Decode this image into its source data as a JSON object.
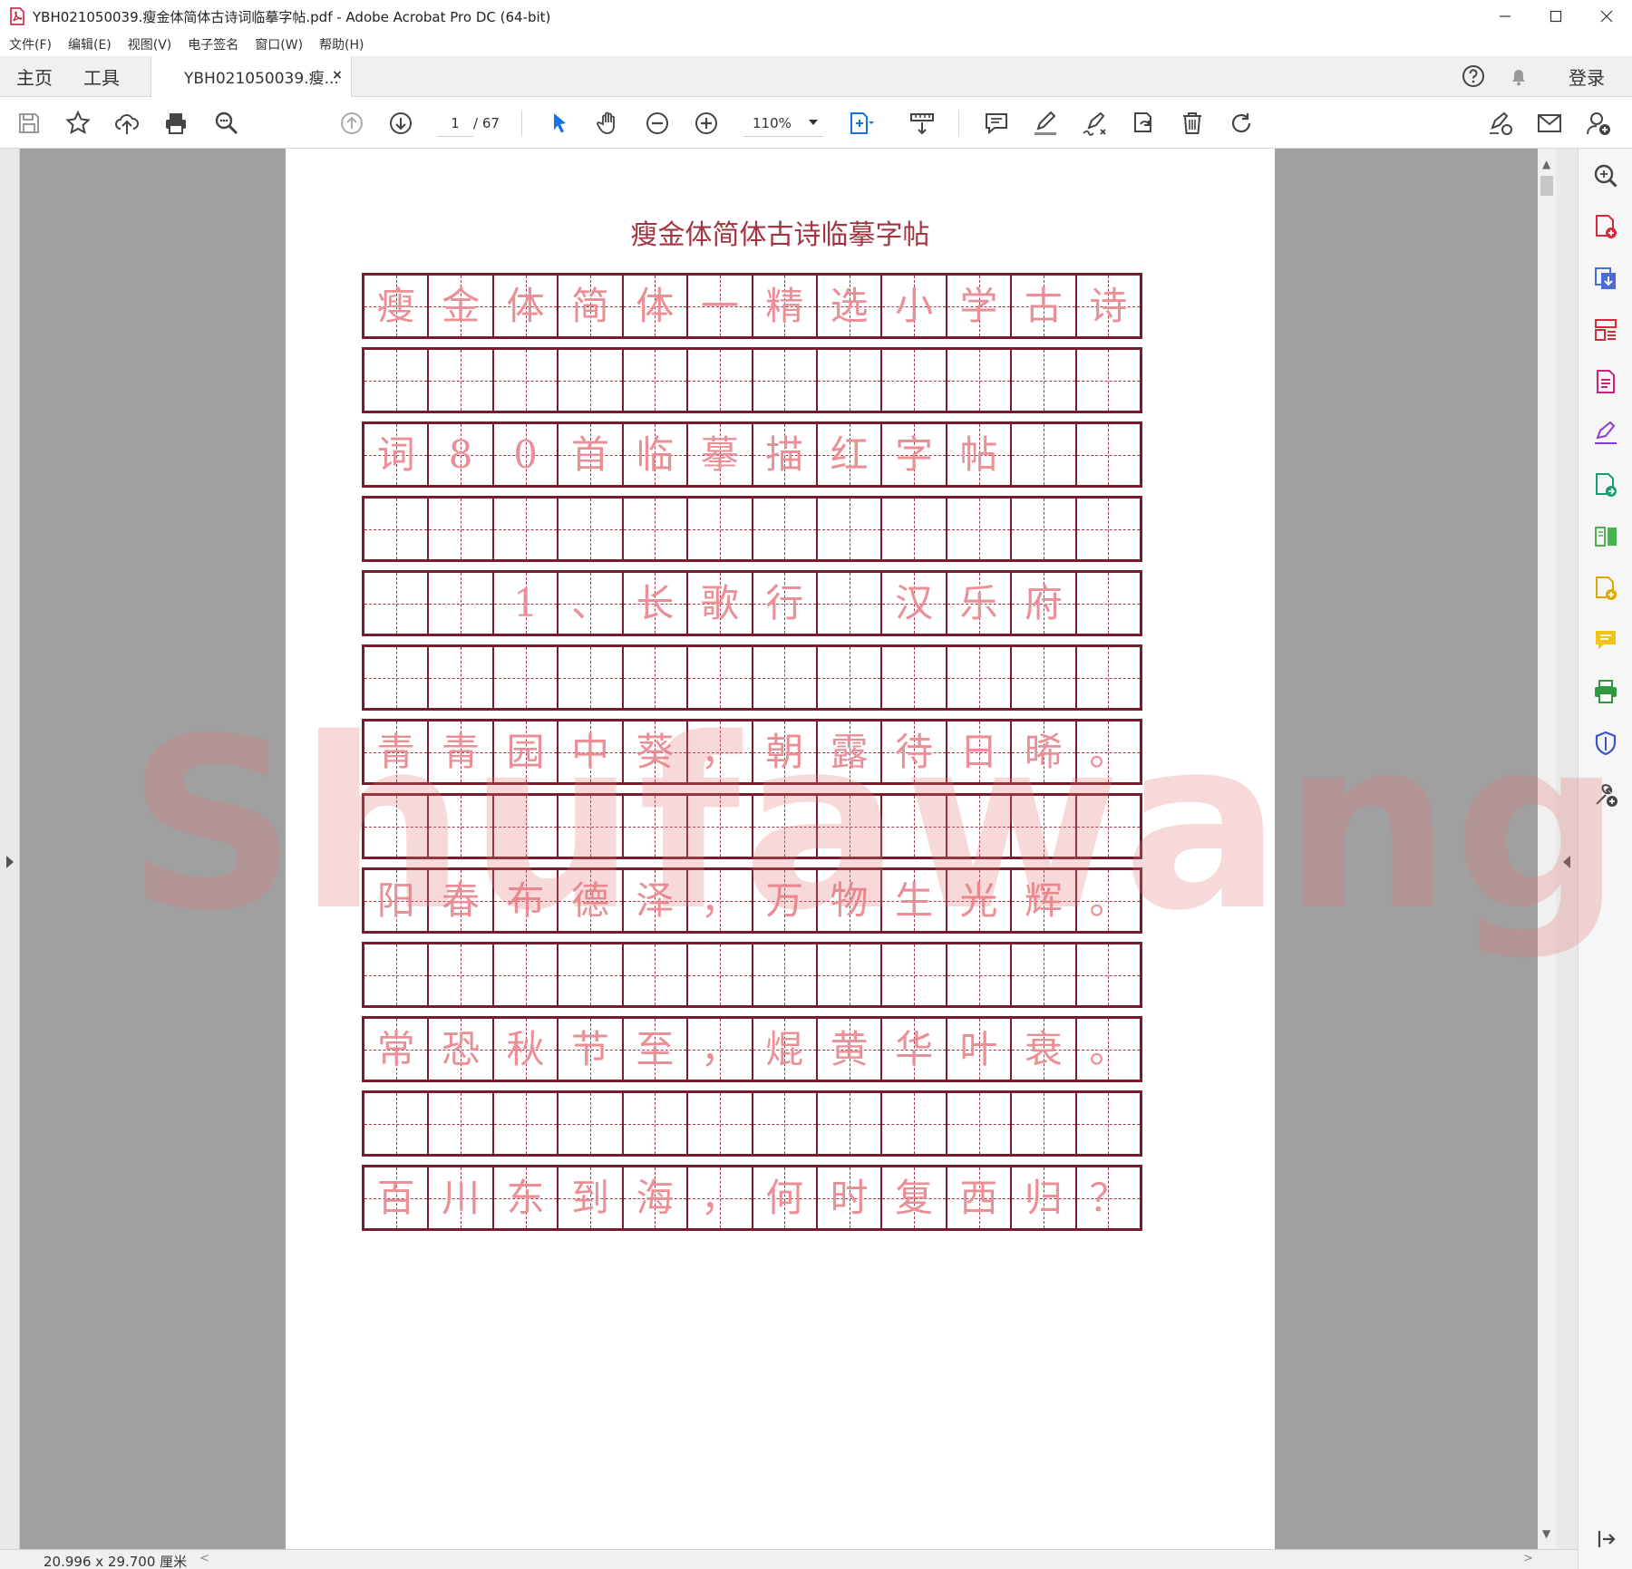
{
  "window": {
    "title": "YBH021050039.瘦金体简体古诗词临摹字帖.pdf - Adobe Acrobat Pro DC (64-bit)"
  },
  "menu": [
    "文件(F)",
    "编辑(E)",
    "视图(V)",
    "电子签名",
    "窗口(W)",
    "帮助(H)"
  ],
  "tabs": {
    "home": "主页",
    "tools": "工具",
    "document": "YBH021050039.瘦...",
    "close": "×",
    "login": "登录"
  },
  "toolbar": {
    "page_current": "1",
    "page_total": "/ 67",
    "zoom": "110%"
  },
  "document": {
    "title": "瘦金体简体古诗临摹字帖",
    "rows": [
      [
        "瘦",
        "金",
        "体",
        "简",
        "体",
        "一",
        "精",
        "选",
        "小",
        "学",
        "古",
        "诗"
      ],
      [
        "",
        "",
        "",
        "",
        "",
        "",
        "",
        "",
        "",
        "",
        "",
        ""
      ],
      [
        "词",
        "8",
        "0",
        "首",
        "临",
        "摹",
        "描",
        "红",
        "字",
        "帖",
        "",
        ""
      ],
      [
        "",
        "",
        "",
        "",
        "",
        "",
        "",
        "",
        "",
        "",
        "",
        ""
      ],
      [
        "",
        "",
        "1",
        "、",
        "长",
        "歌",
        "行",
        "",
        "汉",
        "乐",
        "府",
        ""
      ],
      [
        "",
        "",
        "",
        "",
        "",
        "",
        "",
        "",
        "",
        "",
        "",
        ""
      ],
      [
        "青",
        "青",
        "园",
        "中",
        "葵",
        "，",
        "朝",
        "露",
        "待",
        "日",
        "晞",
        "。"
      ],
      [
        "",
        "",
        "",
        "",
        "",
        "",
        "",
        "",
        "",
        "",
        "",
        ""
      ],
      [
        "阳",
        "春",
        "布",
        "德",
        "泽",
        "，",
        "万",
        "物",
        "生",
        "光",
        "辉",
        "。"
      ],
      [
        "",
        "",
        "",
        "",
        "",
        "",
        "",
        "",
        "",
        "",
        "",
        ""
      ],
      [
        "常",
        "恐",
        "秋",
        "节",
        "至",
        "，",
        "焜",
        "黄",
        "华",
        "叶",
        "衰",
        "。"
      ],
      [
        "",
        "",
        "",
        "",
        "",
        "",
        "",
        "",
        "",
        "",
        "",
        ""
      ],
      [
        "百",
        "川",
        "东",
        "到",
        "海",
        "，",
        "何",
        "时",
        "复",
        "西",
        "归",
        "？"
      ]
    ],
    "watermark": "Shufawang.CN"
  },
  "status": {
    "page_size": "20.996 x 29.700 厘米"
  },
  "colors": {
    "grid_border": "#7c1a2c",
    "trace_text": "#eb8f97",
    "title_text": "#a4343f",
    "viewer_bg": "#a0a0a0",
    "accent_blue": "#1473e6"
  }
}
